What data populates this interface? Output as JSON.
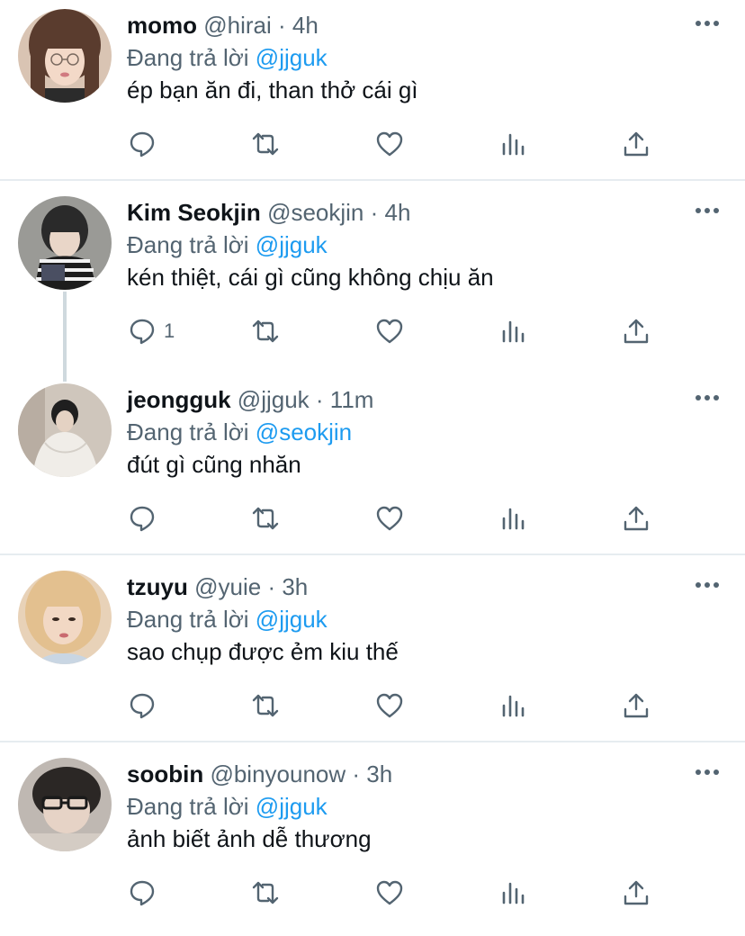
{
  "reply_prefix": "Đang trả lời",
  "tweets": [
    {
      "name": "momo",
      "handle": "@hirai",
      "time": "4h",
      "reply_to": "@jjguk",
      "text": "ép bạn ăn đi, than thở cái gì",
      "reply_count": ""
    },
    {
      "name": "Kim Seokjin",
      "handle": "@seokjin",
      "time": "4h",
      "reply_to": "@jjguk",
      "text": "kén thiệt, cái gì cũng không chịu ăn",
      "reply_count": "1"
    },
    {
      "name": "jeongguk",
      "handle": "@jjguk",
      "time": "11m",
      "reply_to": "@seokjin",
      "text": "đút gì cũng nhăn",
      "reply_count": ""
    },
    {
      "name": "tzuyu",
      "handle": "@yuie",
      "time": "3h",
      "reply_to": "@jjguk",
      "text": "sao chụp được ẻm kiu thế",
      "reply_count": ""
    },
    {
      "name": "soobin",
      "handle": "@binyounow",
      "time": "3h",
      "reply_to": "@jjguk",
      "text": "ảnh biết ảnh dễ thương",
      "reply_count": ""
    }
  ],
  "colors": {
    "text": "#0f1419",
    "secondary": "#536471",
    "mention": "#1d9bf0",
    "separator": "#e6ecf0"
  },
  "icons": [
    "reply-icon",
    "retweet-icon",
    "like-icon",
    "stats-icon",
    "share-icon",
    "more-options-icon"
  ]
}
